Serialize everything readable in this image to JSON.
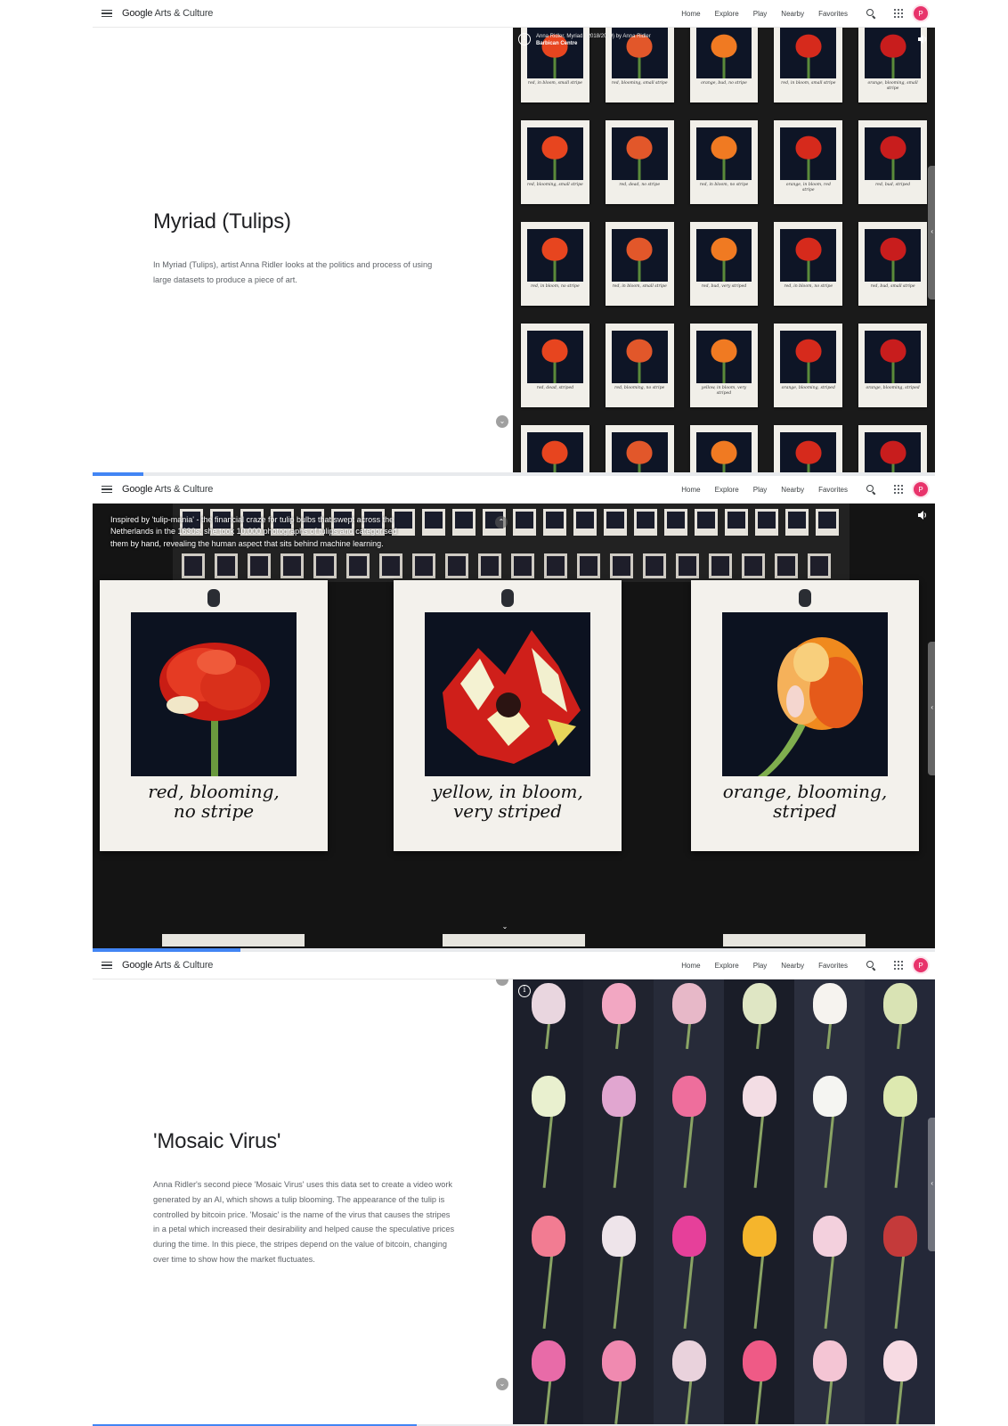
{
  "header": {
    "menu_icon": "hamburger-menu-icon",
    "logo_google": "Google",
    "logo_rest": " Arts & Culture",
    "nav": [
      "Home",
      "Explore",
      "Play",
      "Nearby",
      "Favorites"
    ],
    "search_icon": "search-icon",
    "apps_icon": "apps-grid-icon",
    "avatar_letter": "P",
    "avatar_color": "#e8336b"
  },
  "panel1": {
    "title": "Myriad (Tulips)",
    "body": "In Myriad (Tulips), artist Anna Ridler looks at the politics and process of using large datasets to produce a piece of art.",
    "caption_line1": "Anna Ridler, Myriad, (2018/2019) by Anna Ridler",
    "caption_line2": "Barbican Centre",
    "progress": 0.06,
    "notes": [
      "red, in bloom, small stripe",
      "red, blooming, small stripe",
      "orange, bud, no stripe",
      "red, in bloom, small stripe",
      "orange, blooming, small stripe",
      "red, blooming, small stripe",
      "red, dead, no stripe",
      "red, in bloom, no stripe",
      "orange, in bloom, red stripe",
      "red, bud, striped",
      "red, in bloom, no stripe",
      "red, in bloom, small stripe",
      "red, bud, very striped",
      "red, in bloom, no stripe",
      "red, bud, small stripe",
      "red, dead, striped",
      "red, blooming, no stripe",
      "yellow, in bloom, very striped",
      "orange, blooming, striped",
      "orange, blooming, striped",
      "",
      "",
      "",
      "",
      ""
    ]
  },
  "panel2": {
    "caption": "Inspired by 'tulip-mania' - the financial craze for tulip bulbs that swept across the Netherlands in the 1630s, she took 10,000 photographs of tulips and categorised them by hand, revealing the human aspect that sits behind machine learning.",
    "progress": 0.175,
    "polaroids": [
      {
        "line1": "red, blooming,",
        "line2": "no stripe"
      },
      {
        "line1": "yellow, in bloom,",
        "line2": "very striped"
      },
      {
        "line1": "orange, blooming,",
        "line2": "striped"
      }
    ]
  },
  "panel3": {
    "title": "'Mosaic Virus'",
    "body": "Anna Ridler's second piece 'Mosaic Virus' uses this data set to create a video work generated by an AI, which shows a tulip blooming. The appearance of the tulip is controlled by bitcoin price. 'Mosaic' is the name of the virus that causes the stripes in a petal which increased their desirability and helped cause the speculative prices during the time. In this piece, the stripes depend on the value of bitcoin, changing over time to show how the market fluctuates.",
    "progress": 0.385
  },
  "colors": {
    "accent_blue": "#4285f4",
    "tulip_red": "#d8261c",
    "tulip_orange": "#f07a22",
    "tulip_pink": "#e3588a",
    "background_dark": "#111111"
  }
}
